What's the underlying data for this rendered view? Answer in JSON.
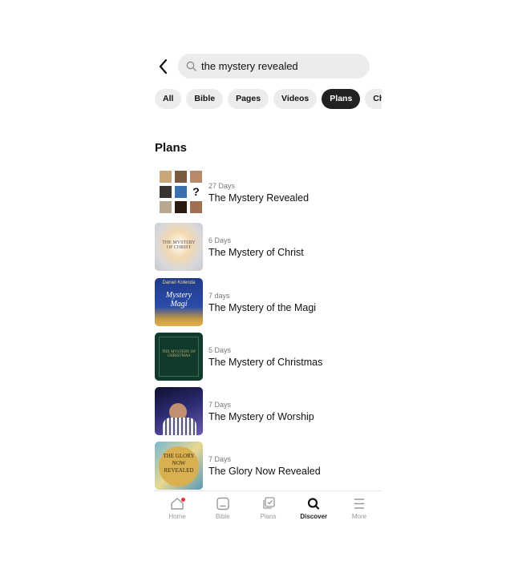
{
  "search": {
    "value": "the mystery revealed",
    "icon": "search-icon"
  },
  "filters": [
    {
      "label": "All",
      "active": false
    },
    {
      "label": "Bible",
      "active": false
    },
    {
      "label": "Pages",
      "active": false
    },
    {
      "label": "Videos",
      "active": false
    },
    {
      "label": "Plans",
      "active": true
    },
    {
      "label": "Churches",
      "active": false
    }
  ],
  "section_title": "Plans",
  "plans": [
    {
      "days": "27 Days",
      "title": "The Mystery Revealed"
    },
    {
      "days": "6 Days",
      "title": "The Mystery of Christ",
      "cover_text": "THE MYSTERY OF CHRIST"
    },
    {
      "days": "7 days",
      "title": "The Mystery of the Magi",
      "cover_text": "Daniel Kolenda",
      "cover_title": "Mystery Magi"
    },
    {
      "days": "5 Days",
      "title": "The Mystery of Christmas",
      "cover_text": "THE MYSTERY OF CHRISTMAS"
    },
    {
      "days": "7 Days",
      "title": "The Mystery of Worship"
    },
    {
      "days": "7 Days",
      "title": "The Glory Now Revealed",
      "cover_text": "THE GLORY NOW REVEALED"
    }
  ],
  "nav": [
    {
      "label": "Home",
      "icon": "home-icon",
      "badge": true
    },
    {
      "label": "Bible",
      "icon": "bible-icon"
    },
    {
      "label": "Plans",
      "icon": "plans-icon"
    },
    {
      "label": "Discover",
      "icon": "search-icon",
      "active": true
    },
    {
      "label": "More",
      "icon": "menu-icon"
    }
  ],
  "colors": {
    "active_chip": "#222222",
    "badge": "#e8323c"
  }
}
